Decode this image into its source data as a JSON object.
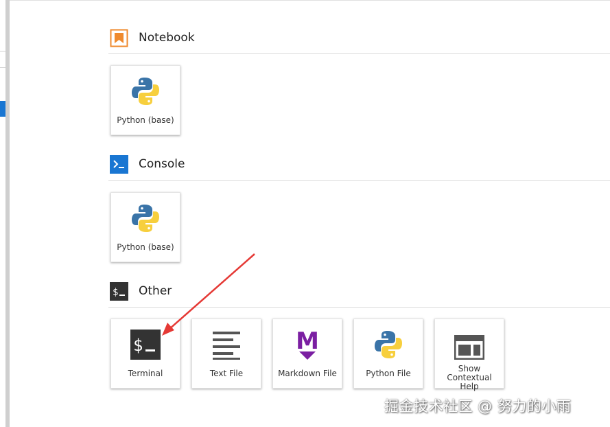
{
  "sections": {
    "notebook": {
      "title": "Notebook",
      "icon": "notebook-bookmark-icon",
      "color": "#ef8a2e"
    },
    "console": {
      "title": "Console",
      "icon": "console-prompt-icon",
      "color": "#1976d2"
    },
    "other": {
      "title": "Other",
      "icon": "terminal-dollar-icon",
      "color": "#333333"
    }
  },
  "cards": {
    "notebook_python": {
      "label": "Python (base)",
      "icon": "python-logo-icon"
    },
    "console_python": {
      "label": "Python (base)",
      "icon": "python-logo-icon"
    },
    "terminal": {
      "label": "Terminal",
      "icon": "terminal-icon"
    },
    "text_file": {
      "label": "Text File",
      "icon": "text-lines-icon"
    },
    "markdown_file": {
      "label": "Markdown File",
      "icon": "markdown-m-icon",
      "color": "#7b1fa2"
    },
    "python_file": {
      "label": "Python File",
      "icon": "python-logo-icon"
    },
    "contextual_help": {
      "label_lines": [
        "Show",
        "Contextual",
        "Help"
      ],
      "icon": "help-window-icon"
    }
  },
  "annotation": {
    "arrow_color": "#e53935"
  },
  "watermark": {
    "text": "掘金技术社区 @ 努力的小雨"
  }
}
